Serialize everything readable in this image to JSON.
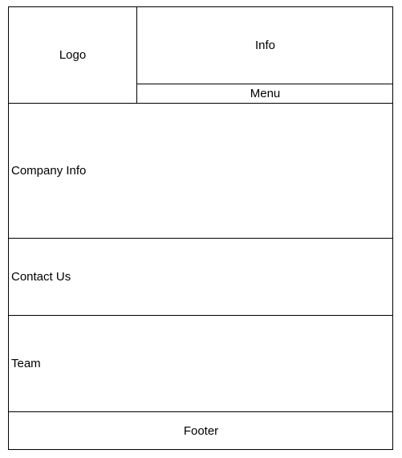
{
  "header": {
    "logo_label": "Logo",
    "info_label": "Info",
    "menu_label": "Menu"
  },
  "sections": {
    "company_info": "Company Info",
    "contact_us": "Contact Us",
    "team": "Team"
  },
  "footer": {
    "label": "Footer"
  }
}
